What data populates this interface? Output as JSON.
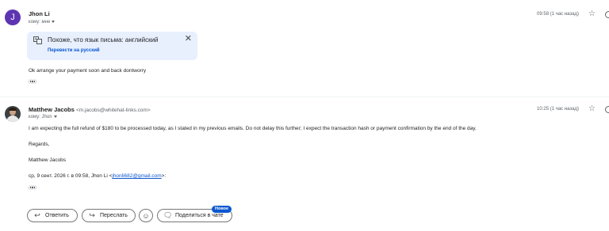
{
  "messages": [
    {
      "avatar_letter": "J",
      "sender_name": "Jhon Li",
      "recipient": "кому: мне",
      "time": "09:58 (1 час назад)",
      "translate_bar": {
        "notice": "Похоже, что язык письма: английский",
        "link": "Перевести на русский"
      },
      "body": "Ok arrange your payment soon and back dontworry"
    },
    {
      "sender_name": "Matthew Jacobs",
      "sender_email": "<m.jacobs@whitehat-links.com>",
      "recipient": "кому: Jhon",
      "time": "10:25 (1 час назад)",
      "body_lines": [
        "I am expecting the full refund of $180 to be processed today, as I stated in my previous emails. Do not delay this further; I expect the transaction hash or payment confirmation by the end of the day.",
        "Regards,",
        "Matthew Jacobs"
      ],
      "quote_prefix": "ср, 9 сент. 2026 г. в 09:58, Jhon Li <",
      "quote_email": "jhonli682@gmail.com",
      "quote_suffix": ">:"
    }
  ],
  "actions": {
    "reply": "Ответить",
    "forward": "Переслать",
    "share_chat": "Поделиться в чате",
    "new_badge": "Новое"
  },
  "colors": {
    "avatar_j": "#5e35b1",
    "accent": "#0b57d0",
    "translate_bg": "#e8f0fe"
  }
}
